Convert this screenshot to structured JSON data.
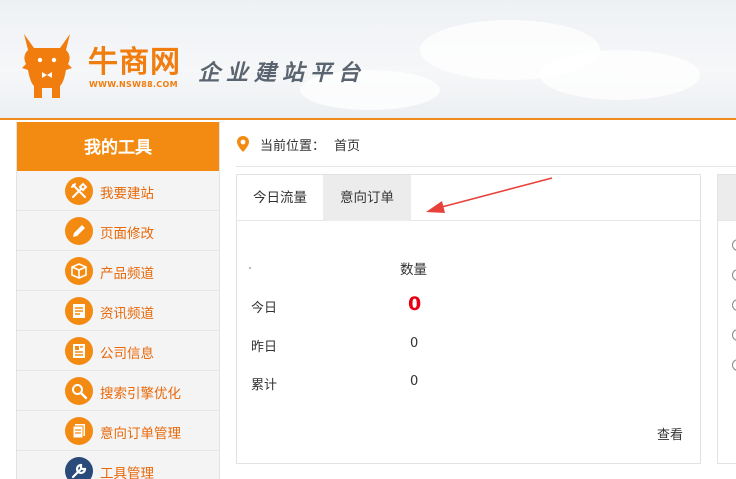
{
  "header": {
    "logo_text": "牛商网",
    "logo_url": "WWW.NSW88.COM",
    "slogan": "企业建站平台"
  },
  "sidebar": {
    "title": "我的工具",
    "items": [
      {
        "label": "我要建站",
        "icon": "tools-icon"
      },
      {
        "label": "页面修改",
        "icon": "pencil-icon"
      },
      {
        "label": "产品频道",
        "icon": "box-icon"
      },
      {
        "label": "资讯频道",
        "icon": "news-icon"
      },
      {
        "label": "公司信息",
        "icon": "company-info-icon"
      },
      {
        "label": "搜索引擎优化",
        "icon": "search-icon"
      },
      {
        "label": "意向订单管理",
        "icon": "document-icon"
      },
      {
        "label": "工具管理",
        "icon": "wrench-icon"
      }
    ]
  },
  "breadcrumb": {
    "label": "当前位置：",
    "current": "首页"
  },
  "panel": {
    "tabs": [
      "今日流量",
      "意向订单"
    ],
    "column_header": "数量",
    "rows": [
      {
        "label": "今日",
        "value": "0"
      },
      {
        "label": "昨日",
        "value": "0"
      },
      {
        "label": "累计",
        "value": "0"
      }
    ],
    "view_link": "查看"
  },
  "colors": {
    "accent": "#f38b12",
    "highlight": "#e60012",
    "arrow": "#e8413a"
  }
}
